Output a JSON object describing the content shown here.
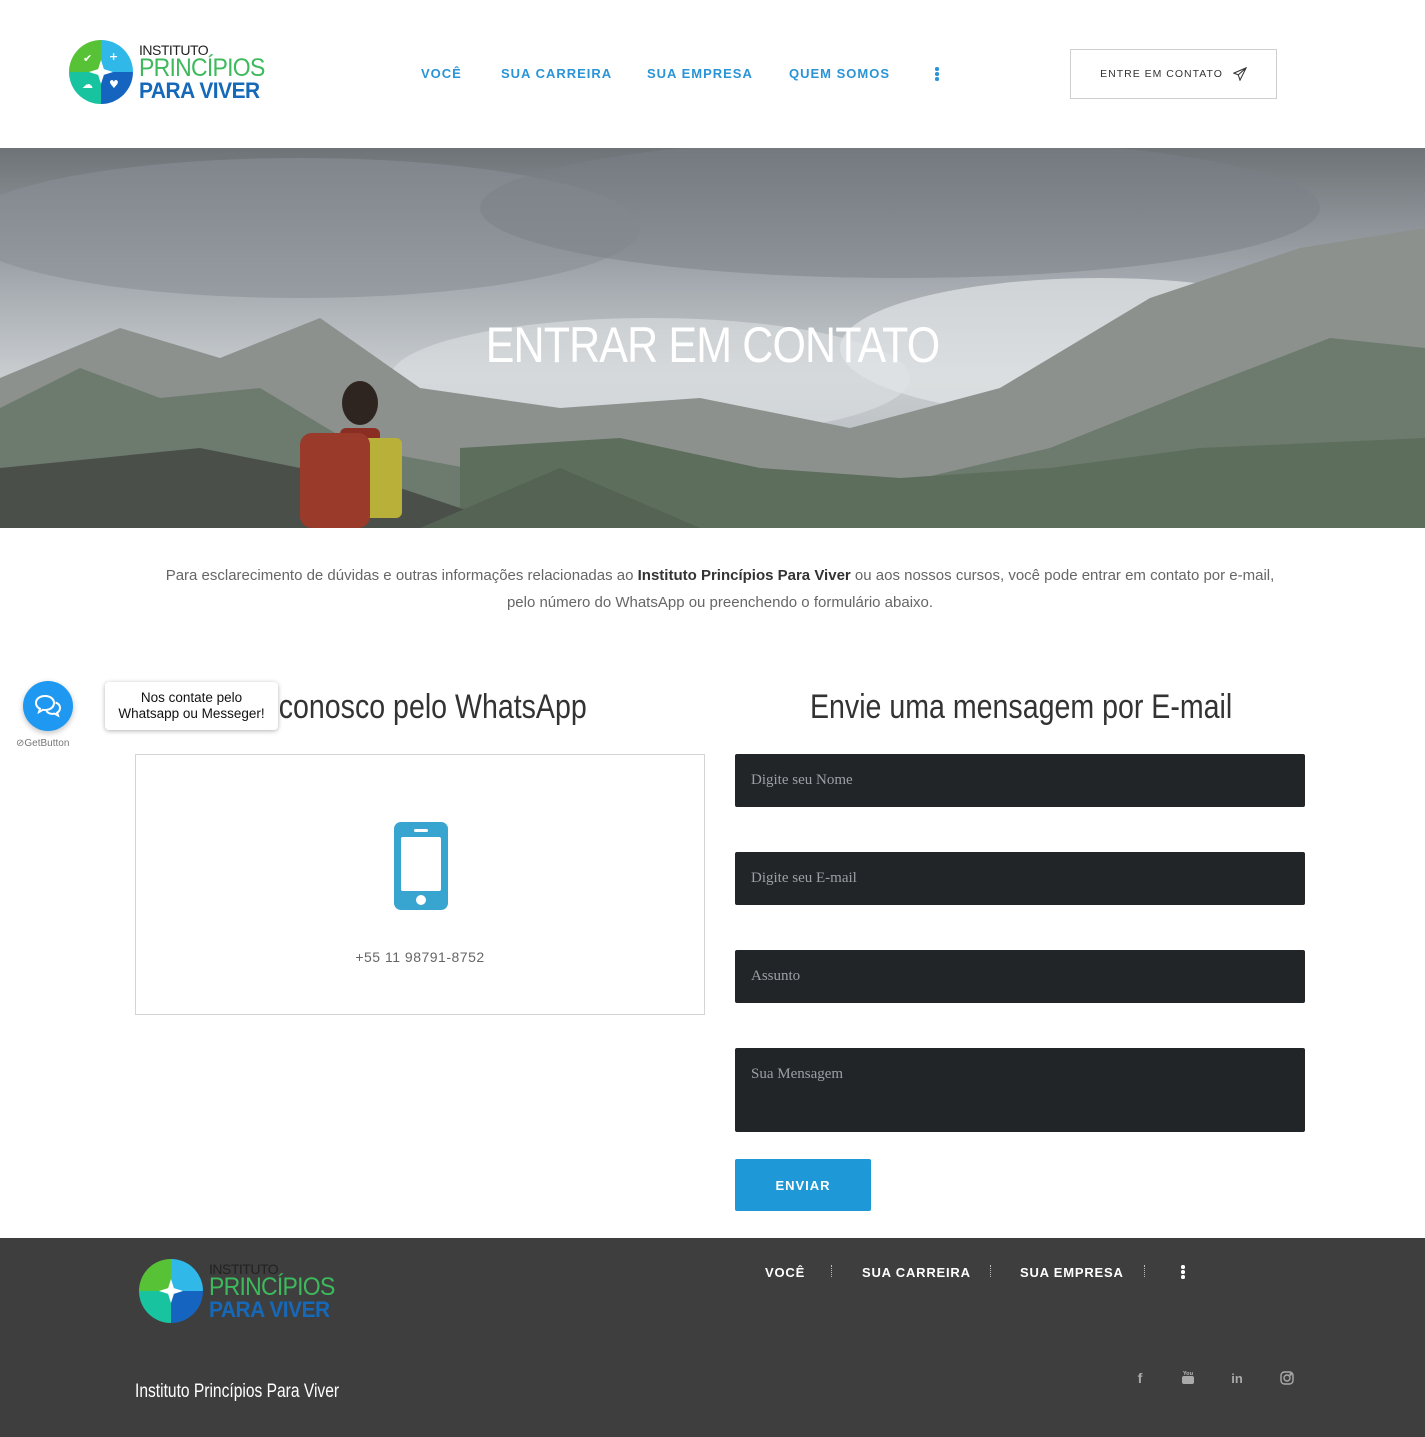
{
  "header": {
    "logo": {
      "line1": "INSTITUTO",
      "line2": "PRINCÍPIOS",
      "line3": "PARA VIVER"
    },
    "nav": [
      "VOCÊ",
      "SUA CARREIRA",
      "SUA EMPRESA",
      "QUEM SOMOS"
    ],
    "more_icon": "vertical-dots-icon",
    "contact_button": "ENTRE EM CONTATO",
    "contact_icon": "paper-plane-icon",
    "accent_color": "#2a94d6"
  },
  "hero": {
    "title": "ENTRAR EM CONTATO"
  },
  "intro": {
    "before": "Para esclarecimento de dúvidas e outras informações relacionadas ao ",
    "strong": "Instituto Princípios Para Viver",
    "after": " ou aos nossos cursos, você pode entrar em contato por e-mail,",
    "line2": "pelo número do WhatsApp ou preenchendo o formulário abaixo."
  },
  "whatsapp": {
    "heading": "Fale conosco pelo WhatsApp",
    "icon": "mobile-phone-icon",
    "phone": "+55 11 98791-8752"
  },
  "email_form": {
    "heading": "Envie uma mensagem por E-mail",
    "name_placeholder": "Digite seu Nome",
    "email_placeholder": "Digite seu E-mail",
    "subject_placeholder": "Assunto",
    "message_placeholder": "Sua Mensagem",
    "submit": "ENVIAR",
    "button_color": "#1e98d6"
  },
  "getbutton": {
    "tooltip_line1": "Nos contate pelo",
    "tooltip_line2": "Whatsapp ou Messeger!",
    "brand": "GetButton",
    "icon": "chat-bubbles-icon"
  },
  "footer": {
    "logo": {
      "line1": "INSTITUTO",
      "line2": "PRINCÍPIOS",
      "line3": "PARA VIVER"
    },
    "nav": [
      "VOCÊ",
      "SUA CARREIRA",
      "SUA EMPRESA"
    ],
    "more_icon": "vertical-dots-icon",
    "name": "Instituto Princípios Para Viver",
    "social": [
      "facebook-icon",
      "youtube-icon",
      "linkedin-icon",
      "instagram-icon"
    ],
    "background": "#3e3e3e"
  }
}
